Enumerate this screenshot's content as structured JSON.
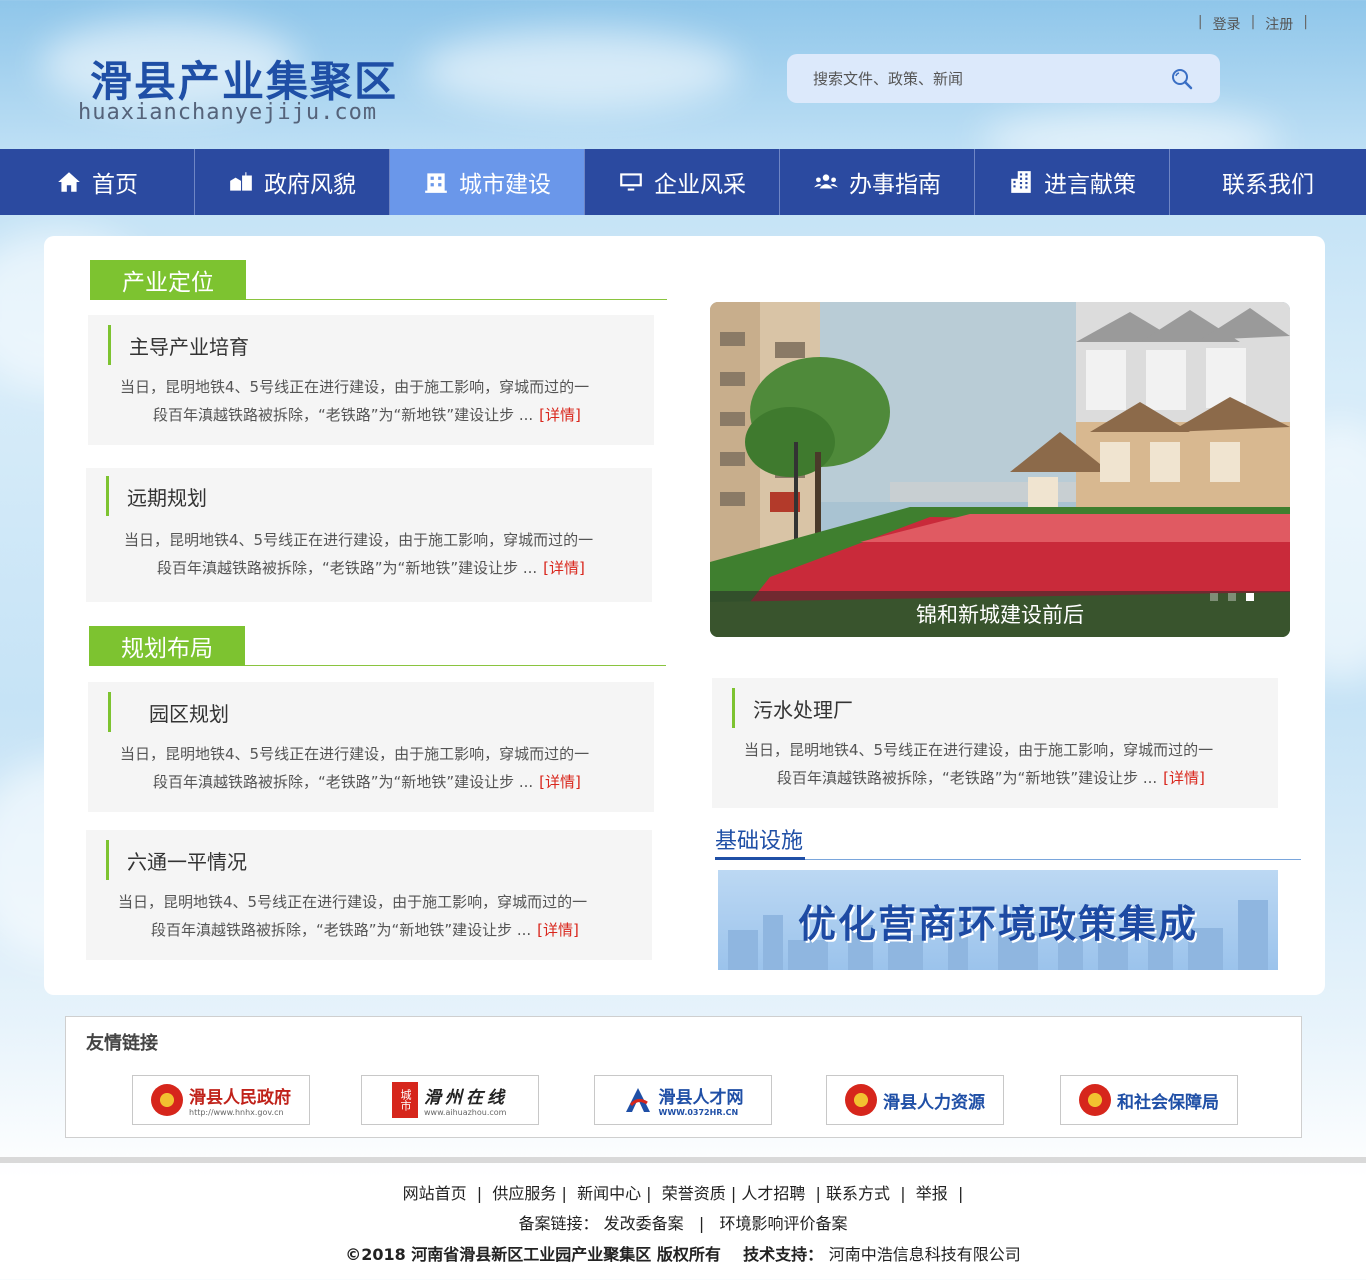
{
  "header": {
    "login": "登录",
    "register": "注册",
    "logo_cn": "滑县产业集聚区",
    "logo_en": "huaxianchanyejiju.com",
    "search_placeholder": "搜索文件、政策、新闻"
  },
  "nav": [
    {
      "label": "首页",
      "icon": "home-icon",
      "active": false
    },
    {
      "label": "政府风貌",
      "icon": "government-icon",
      "active": false
    },
    {
      "label": "城市建设",
      "icon": "building-icon",
      "active": true
    },
    {
      "label": "企业风采",
      "icon": "monitor-icon",
      "active": false
    },
    {
      "label": "办事指南",
      "icon": "people-icon",
      "active": false
    },
    {
      "label": "进言献策",
      "icon": "office-icon",
      "active": false
    },
    {
      "label": "联系我们",
      "icon": "",
      "active": false
    }
  ],
  "sections": {
    "positioning": "产业定位",
    "layout": "规划布局",
    "infrastructure": "基础设施"
  },
  "articles": [
    {
      "title": "主导产业培育",
      "line1": "当日，昆明地铁4、5号线正在进行建设，由于施工影响，穿城而过的一",
      "line2": "段百年滇越铁路被拆除，“老铁路”为“新地铁”建设让步 ...",
      "more": "[详情]"
    },
    {
      "title": "远期规划",
      "line1": "当日，昆明地铁4、5号线正在进行建设，由于施工影响，穿城而过的一",
      "line2": "段百年滇越铁路被拆除，“老铁路”为“新地铁”建设让步 ...",
      "more": "[详情]"
    },
    {
      "title": "园区规划",
      "line1": "当日，昆明地铁4、5号线正在进行建设，由于施工影响，穿城而过的一",
      "line2": "段百年滇越铁路被拆除，“老铁路”为“新地铁”建设让步 ...",
      "more": "[详情]"
    },
    {
      "title": "六通一平情况",
      "line1": "当日，昆明地铁4、5号线正在进行建设，由于施工影响，穿城而过的一",
      "line2": "段百年滇越铁路被拆除，“老铁路”为“新地铁”建设让步 ...",
      "more": "[详情]"
    },
    {
      "title": "污水处理厂",
      "line1": "当日，昆明地铁4、5号线正在进行建设，由于施工影响，穿城而过的一",
      "line2": "段百年滇越铁路被拆除，“老铁路”为“新地铁”建设让步 ...",
      "more": "[详情]"
    }
  ],
  "slideshow": {
    "caption": "锦和新城建设前后",
    "dot_count": 3,
    "active_dot": 3
  },
  "banner": {
    "text": "优化营商环境政策集成"
  },
  "friends": {
    "heading": "友情链接",
    "links": [
      {
        "label": "滑县人民政府",
        "sub": "http://www.hnhx.gov.cn",
        "color": "#c0221a",
        "icon": "national-emblem-icon"
      },
      {
        "label": "滑州在线",
        "sub": "www.aihuazhou.com",
        "color": "#222222",
        "icon": "city-logo-icon"
      },
      {
        "label": "滑县人才网",
        "sub": "WWW.0372HR.CN",
        "color": "#1f4fa6",
        "icon": "talent-logo-icon"
      },
      {
        "label": "滑县人力资源",
        "sub": "",
        "color": "#1f4fa6",
        "icon": "national-emblem-icon"
      },
      {
        "label": "和社会保障局",
        "sub": "",
        "color": "#1f4fa6",
        "icon": "national-emblem-icon"
      }
    ]
  },
  "footer": {
    "nav": [
      "网站首页",
      "供应服务",
      "新闻中心",
      "荣誉资质",
      "人才招聘",
      "联系方式",
      "举报"
    ],
    "record_label": "备案链接：",
    "record_links": [
      "发改委备案",
      "环境影响评价备案"
    ],
    "copyright": "©2018 河南省滑县新区工业园产业聚集区 版权所有",
    "support_label": "技术支持：",
    "support": "河南中浩信息科技有限公司"
  },
  "colors": {
    "nav_bg": "#2b4aa0",
    "nav_active": "#6a97ea",
    "green_accent": "#7dc330",
    "more_link": "#d9261c",
    "brand_blue": "#1f4fa6"
  }
}
